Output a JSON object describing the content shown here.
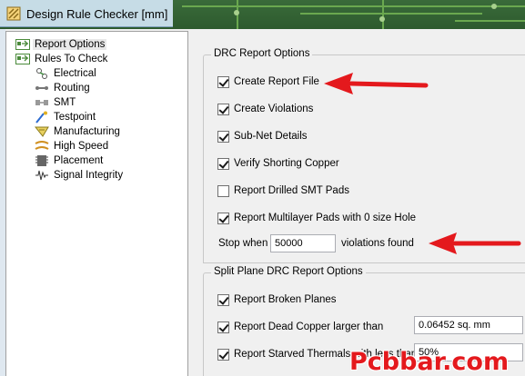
{
  "window": {
    "title": "Design Rule Checker [mm]"
  },
  "tree": [
    {
      "label": "Report Options",
      "icon": "report-options-icon",
      "level": 0,
      "selected": true
    },
    {
      "label": "Rules To Check",
      "icon": "rules-to-check-icon",
      "level": 0
    },
    {
      "label": "Electrical",
      "icon": "electrical-icon",
      "level": 1
    },
    {
      "label": "Routing",
      "icon": "routing-icon",
      "level": 1
    },
    {
      "label": "SMT",
      "icon": "smt-icon",
      "level": 1
    },
    {
      "label": "Testpoint",
      "icon": "testpoint-icon",
      "level": 1
    },
    {
      "label": "Manufacturing",
      "icon": "manufacturing-icon",
      "level": 1
    },
    {
      "label": "High Speed",
      "icon": "high-speed-icon",
      "level": 1
    },
    {
      "label": "Placement",
      "icon": "placement-icon",
      "level": 1
    },
    {
      "label": "Signal Integrity",
      "icon": "signal-integrity-icon",
      "level": 1
    }
  ],
  "drc_report": {
    "title": "DRC Report Options",
    "options": [
      {
        "label": "Create Report File",
        "checked": true
      },
      {
        "label": "Create Violations",
        "checked": true
      },
      {
        "label": "Sub-Net Details",
        "checked": true
      },
      {
        "label": "Verify Shorting Copper",
        "checked": true
      },
      {
        "label": "Report Drilled SMT Pads",
        "checked": false
      },
      {
        "label": "Report Multilayer Pads with 0 size Hole",
        "checked": true
      }
    ],
    "stop_when_label": "Stop when",
    "stop_when_value": "50000",
    "violations_found_label": "violations found"
  },
  "split_plane": {
    "title": "Split Plane DRC Report Options",
    "options": [
      {
        "label": "Report Broken Planes",
        "checked": true
      },
      {
        "label": "Report Dead Copper larger than",
        "checked": true,
        "value": "0.06452 sq. mm"
      },
      {
        "label": "Report Starved Thermals with less than",
        "checked": true,
        "value": "50%"
      }
    ]
  },
  "watermark": "Pcbbar.com",
  "colors": {
    "arrow": "#e4191d",
    "titlebar_pcb": "#2d5a2e",
    "selection": "#e8e8e8"
  }
}
